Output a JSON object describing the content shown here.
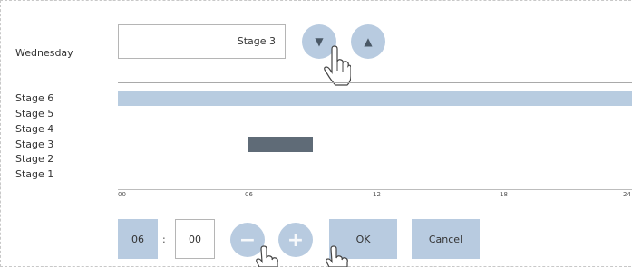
{
  "day": "Wednesday",
  "stage_selector": {
    "value": "Stage 3"
  },
  "buttons": {
    "down_icon": "▼",
    "up_icon": "▲",
    "minus_icon": "−",
    "plus_icon": "+",
    "ok": "OK",
    "cancel": "Cancel"
  },
  "stages": [
    "Stage 6",
    "Stage 5",
    "Stage 4",
    "Stage 3",
    "Stage 2",
    "Stage 1"
  ],
  "timeline": {
    "ticks": [
      "00",
      "06",
      "12",
      "18",
      "24"
    ],
    "current_time_hours": 6
  },
  "time_input": {
    "hours": "06",
    "separator": ":",
    "minutes": "00"
  },
  "colors": {
    "accent": "#b8cbe0",
    "active_bar": "#5f6b77",
    "marker": "#e04040"
  },
  "icons": [
    "chevron-down-icon",
    "chevron-up-icon",
    "minus-icon",
    "plus-icon",
    "hand-pointer-icon"
  ]
}
